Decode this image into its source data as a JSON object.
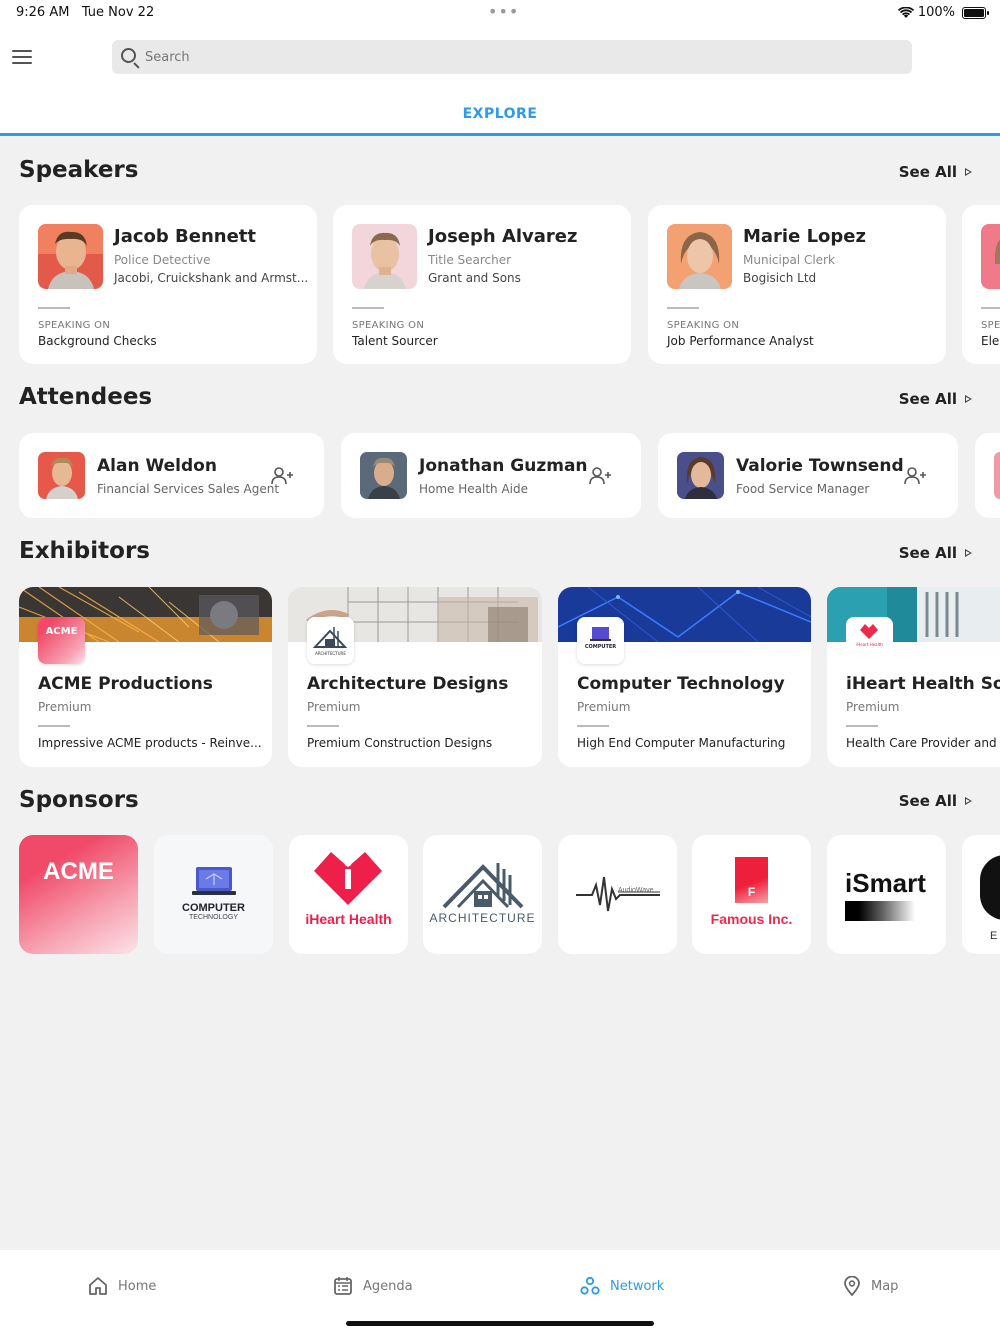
{
  "status_bar": {
    "time": "9:26 AM",
    "date": "Tue Nov 22",
    "battery": "100%"
  },
  "search": {
    "placeholder": "Search"
  },
  "tab": {
    "label": "EXPLORE"
  },
  "speakers": {
    "title": "Speakers",
    "see_all": "See All",
    "items": [
      {
        "name": "Jacob Bennett",
        "role": "Police Detective",
        "company": "Jacobi, Cruickshank and Armst...",
        "speaking_label": "SPEAKING ON",
        "topic": "Background Checks"
      },
      {
        "name": "Joseph Alvarez",
        "role": "Title Searcher",
        "company": "Grant and Sons",
        "speaking_label": "SPEAKING ON",
        "topic": "Talent Sourcer"
      },
      {
        "name": "Marie Lopez",
        "role": "Municipal Clerk",
        "company": "Bogisich Ltd",
        "speaking_label": "SPEAKING ON",
        "topic": "Job Performance Analyst"
      },
      {
        "name": "",
        "role": "",
        "company": "",
        "speaking_label": "SPE",
        "topic": "Ele"
      }
    ]
  },
  "attendees": {
    "title": "Attendees",
    "see_all": "See All",
    "items": [
      {
        "name": "Alan Weldon",
        "role": "Financial Services Sales Agent"
      },
      {
        "name": "Jonathan Guzman",
        "role": "Home Health Aide"
      },
      {
        "name": "Valorie Townsend",
        "role": "Food Service Manager"
      }
    ]
  },
  "exhibitors": {
    "title": "Exhibitors",
    "see_all": "See All",
    "items": [
      {
        "name": "ACME Productions",
        "tier": "Premium",
        "desc": "Impressive ACME products - Reinve...",
        "logo_text": "ACME"
      },
      {
        "name": "Architecture Designs",
        "tier": "Premium",
        "desc": "Premium Construction Designs",
        "logo_text": "ARCHITECTURE"
      },
      {
        "name": "Computer Technology",
        "tier": "Premium",
        "desc": "High End Computer Manufacturing",
        "logo_text": "COMPUTER"
      },
      {
        "name": "iHeart Health Sol",
        "tier": "Premium",
        "desc": "Health Care Provider and S",
        "logo_text": "iHeart Health"
      }
    ]
  },
  "sponsors": {
    "title": "Sponsors",
    "see_all": "See All",
    "items": [
      {
        "name": "ACME"
      },
      {
        "name": "COMPUTER",
        "sub": "TECHNOLOGY"
      },
      {
        "name": "iHeart Health"
      },
      {
        "name": "ARCHITECTURE"
      },
      {
        "name": "AudioWave"
      },
      {
        "name": "Famous Inc.",
        "mark": "F"
      },
      {
        "name": "iSmart"
      },
      {
        "name": "E"
      }
    ]
  },
  "bottom_nav": {
    "items": [
      {
        "label": "Home"
      },
      {
        "label": "Agenda"
      },
      {
        "label": "Network",
        "active": true
      },
      {
        "label": "Map"
      }
    ]
  },
  "colors": {
    "accent": "#2b9be8",
    "brand_pink": "#f0506e"
  }
}
